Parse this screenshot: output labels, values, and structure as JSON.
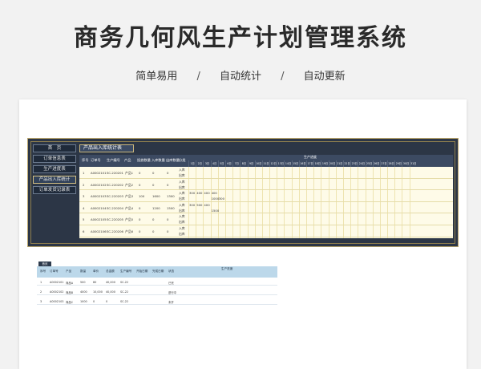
{
  "title": "商务几何风生产计划管理系统",
  "tags": [
    "简单易用",
    "自动统计",
    "自动更新"
  ],
  "separator": "/",
  "nav": {
    "items": [
      {
        "label": "首　页"
      },
      {
        "label": "订单信息表"
      },
      {
        "label": "生产进度表"
      },
      {
        "label": "产品出入库统计"
      },
      {
        "label": "订单发货记录表"
      }
    ],
    "active_index": 3
  },
  "panel": {
    "title": "产品出入库统计表",
    "columns": [
      "序号",
      "订单号",
      "生产编号",
      "产品",
      "投放数量",
      "入库数量",
      "出库数量",
      "分类"
    ],
    "plan_label": "生产进度",
    "days": [
      "1日",
      "2日",
      "3日",
      "4日",
      "5日",
      "6日",
      "7日",
      "8日",
      "9日",
      "10日",
      "11日",
      "12日",
      "13日",
      "14日",
      "15日",
      "16日",
      "17日",
      "18日",
      "19日",
      "20日",
      "21日",
      "22日",
      "23日",
      "24日",
      "25日",
      "26日",
      "27日",
      "28日",
      "29日",
      "30日",
      "31日"
    ],
    "rows": [
      {
        "no": "1",
        "order": "A0002101",
        "prod_no": "SC-220201",
        "product": "产品1",
        "qty": "0",
        "in": "0",
        "out": "0",
        "types": [
          "入库",
          "出库"
        ],
        "vals_in": [],
        "vals_out": []
      },
      {
        "no": "2",
        "order": "A0002102",
        "prod_no": "SC-220202",
        "product": "产品2",
        "qty": "0",
        "in": "0",
        "out": "0",
        "types": [
          "入库",
          "出库"
        ],
        "vals_in": [],
        "vals_out": []
      },
      {
        "no": "3",
        "order": "A0002103",
        "prod_no": "SC-220203",
        "product": "产品3",
        "qty": "100",
        "in": "1600",
        "out": "1300",
        "types": [
          "入库",
          "出库"
        ],
        "vals_in": [
          "300",
          "400",
          "400",
          "400"
        ],
        "vals_out": [
          "1000",
          "300"
        ]
      },
      {
        "no": "4",
        "order": "A0002104",
        "prod_no": "SC-220204",
        "product": "产品4",
        "qty": "0",
        "in": "1200",
        "out": "1500",
        "types": [
          "入库",
          "出库"
        ],
        "vals_in": [
          "300",
          "500",
          "400"
        ],
        "vals_out": [
          "1500"
        ]
      },
      {
        "no": "5",
        "order": "A0002105",
        "prod_no": "SC-220205",
        "product": "产品5",
        "qty": "0",
        "in": "0",
        "out": "0",
        "types": [
          "入库",
          "出库"
        ],
        "vals_in": [],
        "vals_out": []
      },
      {
        "no": "6",
        "order": "A0002106",
        "prod_no": "SC-220206",
        "product": "产品6",
        "qty": "0",
        "in": "0",
        "out": "0",
        "types": [
          "入库",
          "出库"
        ],
        "vals_in": [],
        "vals_out": []
      }
    ]
  },
  "preview": {
    "tag": "首页",
    "plan_label": "生产进度",
    "headers": [
      "序号",
      "订单号",
      "产品",
      "数量",
      "单价",
      "总金额",
      "生产编号",
      "开始日期",
      "完成日期",
      "状态"
    ],
    "rows": [
      {
        "no": "1",
        "order": "A0002101",
        "product": "商品A",
        "qty": "500",
        "price": "80",
        "total": "40,000",
        "prod_no": "SC-22",
        "status": "已完"
      },
      {
        "no": "2",
        "order": "A0002102",
        "product": "商品B",
        "qty": "4000",
        "price": "10,000",
        "total": "40,000",
        "prod_no": "SC-22",
        "status": "进行中"
      },
      {
        "no": "3",
        "order": "A0002103",
        "product": "商品C",
        "qty": "1000",
        "price": "0",
        "total": "0",
        "prod_no": "SC-22",
        "status": "未开"
      }
    ]
  }
}
